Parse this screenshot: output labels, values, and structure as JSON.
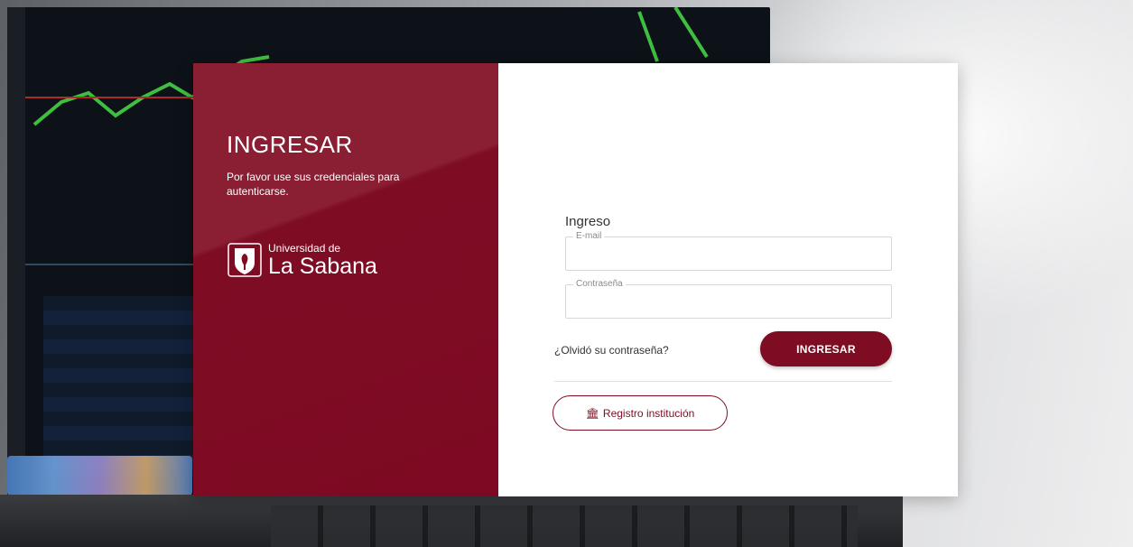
{
  "panel": {
    "title": "INGRESAR",
    "subtitle": "Por favor use sus credenciales para autenticarse.",
    "logo": {
      "line1": "Universidad de",
      "line2": "La Sabana",
      "seal_icon": "university-seal-icon"
    }
  },
  "form": {
    "title": "Ingreso",
    "email": {
      "label": "E-mail",
      "value": ""
    },
    "password": {
      "label": "Contraseña",
      "value": ""
    },
    "forgot_label": "¿Olvidó su contraseña?",
    "submit_label": "INGRESAR",
    "register_label": "Registro institución",
    "register_icon": "institution-building-icon"
  },
  "colors": {
    "brand": "#7e0c22",
    "brand_light": "#8a1e33",
    "field_border": "#d7d7d7"
  }
}
